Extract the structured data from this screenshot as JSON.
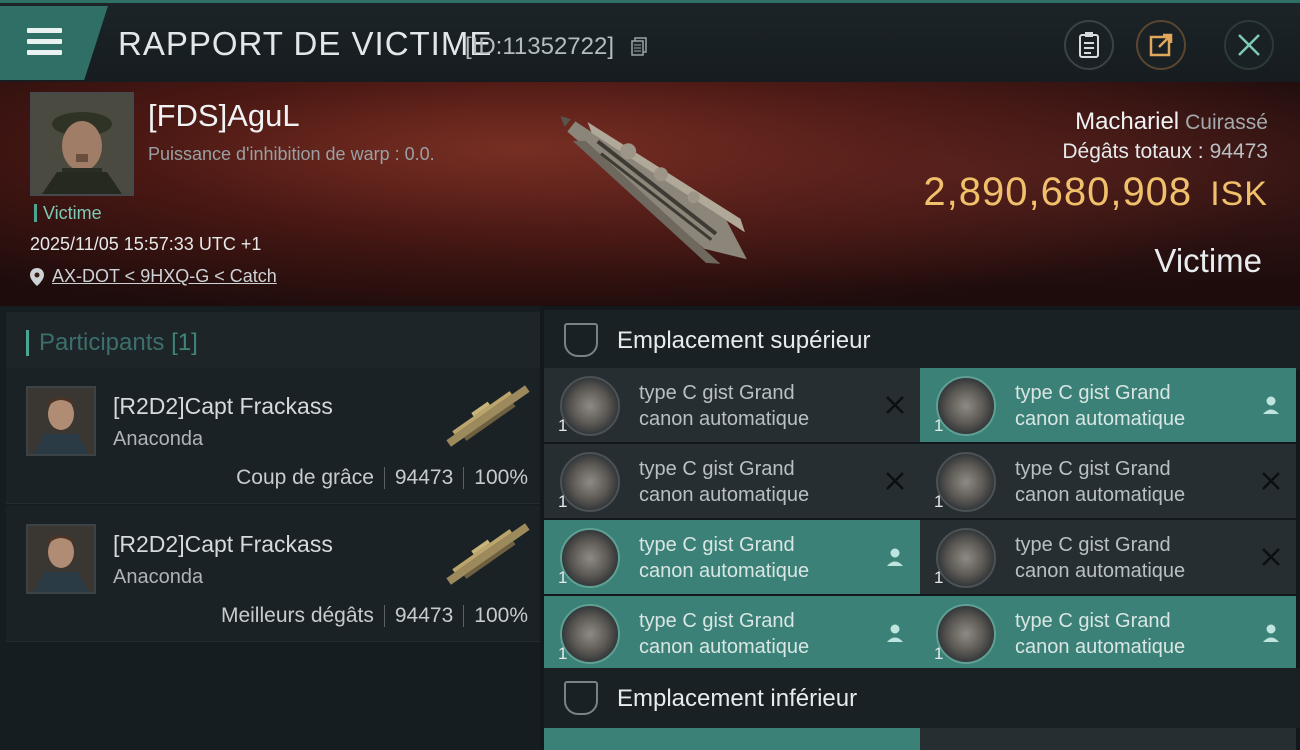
{
  "header": {
    "title": "RAPPORT DE VICTIME",
    "report_id": "[ID:11352722]"
  },
  "victim": {
    "name": "[FDS]AguL",
    "warp_label": "Puissance d'inhibition de warp : 0.0.",
    "role": "Victime",
    "datetime": "2025/11/05 15:57:33 UTC +1",
    "location": "AX-DOT < 9HXQ-G < Catch",
    "ship_name": "Machariel",
    "ship_class": "Cuirassé",
    "damage_label": "Dégâts totaux :",
    "damage_value": "94473",
    "isk_value": "2,890,680,908",
    "isk_unit": "ISK",
    "status": "Victime"
  },
  "participants": {
    "label": "Participants",
    "count": "[1]",
    "rows": [
      {
        "name": "[R2D2]Capt Frackass",
        "ship": "Anaconda",
        "type": "Coup de grâce",
        "damage": "94473",
        "percent": "100%"
      },
      {
        "name": "[R2D2]Capt Frackass",
        "ship": "Anaconda",
        "type": "Meilleurs dégâts",
        "damage": "94473",
        "percent": "100%"
      }
    ]
  },
  "slots": {
    "high_label": "Emplacement supérieur",
    "low_label": "Emplacement inférieur",
    "high_items": [
      {
        "line1": "type C gist Grand",
        "line2": "canon automatique",
        "qty": "1",
        "state": "destroyed"
      },
      {
        "line1": "type C gist Grand",
        "line2": "canon automatique",
        "qty": "1",
        "state": "dropped"
      },
      {
        "line1": "type C gist Grand",
        "line2": "canon automatique",
        "qty": "1",
        "state": "destroyed"
      },
      {
        "line1": "type C gist Grand",
        "line2": "canon automatique",
        "qty": "1",
        "state": "destroyed"
      },
      {
        "line1": "type C gist Grand",
        "line2": "canon automatique",
        "qty": "1",
        "state": "dropped"
      },
      {
        "line1": "type C gist Grand",
        "line2": "canon automatique",
        "qty": "1",
        "state": "destroyed"
      },
      {
        "line1": "type C gist Grand",
        "line2": "canon automatique",
        "qty": "1",
        "state": "dropped"
      },
      {
        "line1": "type C gist Grand",
        "line2": "canon automatique",
        "qty": "1",
        "state": "dropped"
      }
    ]
  },
  "colors": {
    "accent": "#3b8177",
    "isk": "#f0c06b",
    "victim_tag": "#7fc9b6"
  }
}
